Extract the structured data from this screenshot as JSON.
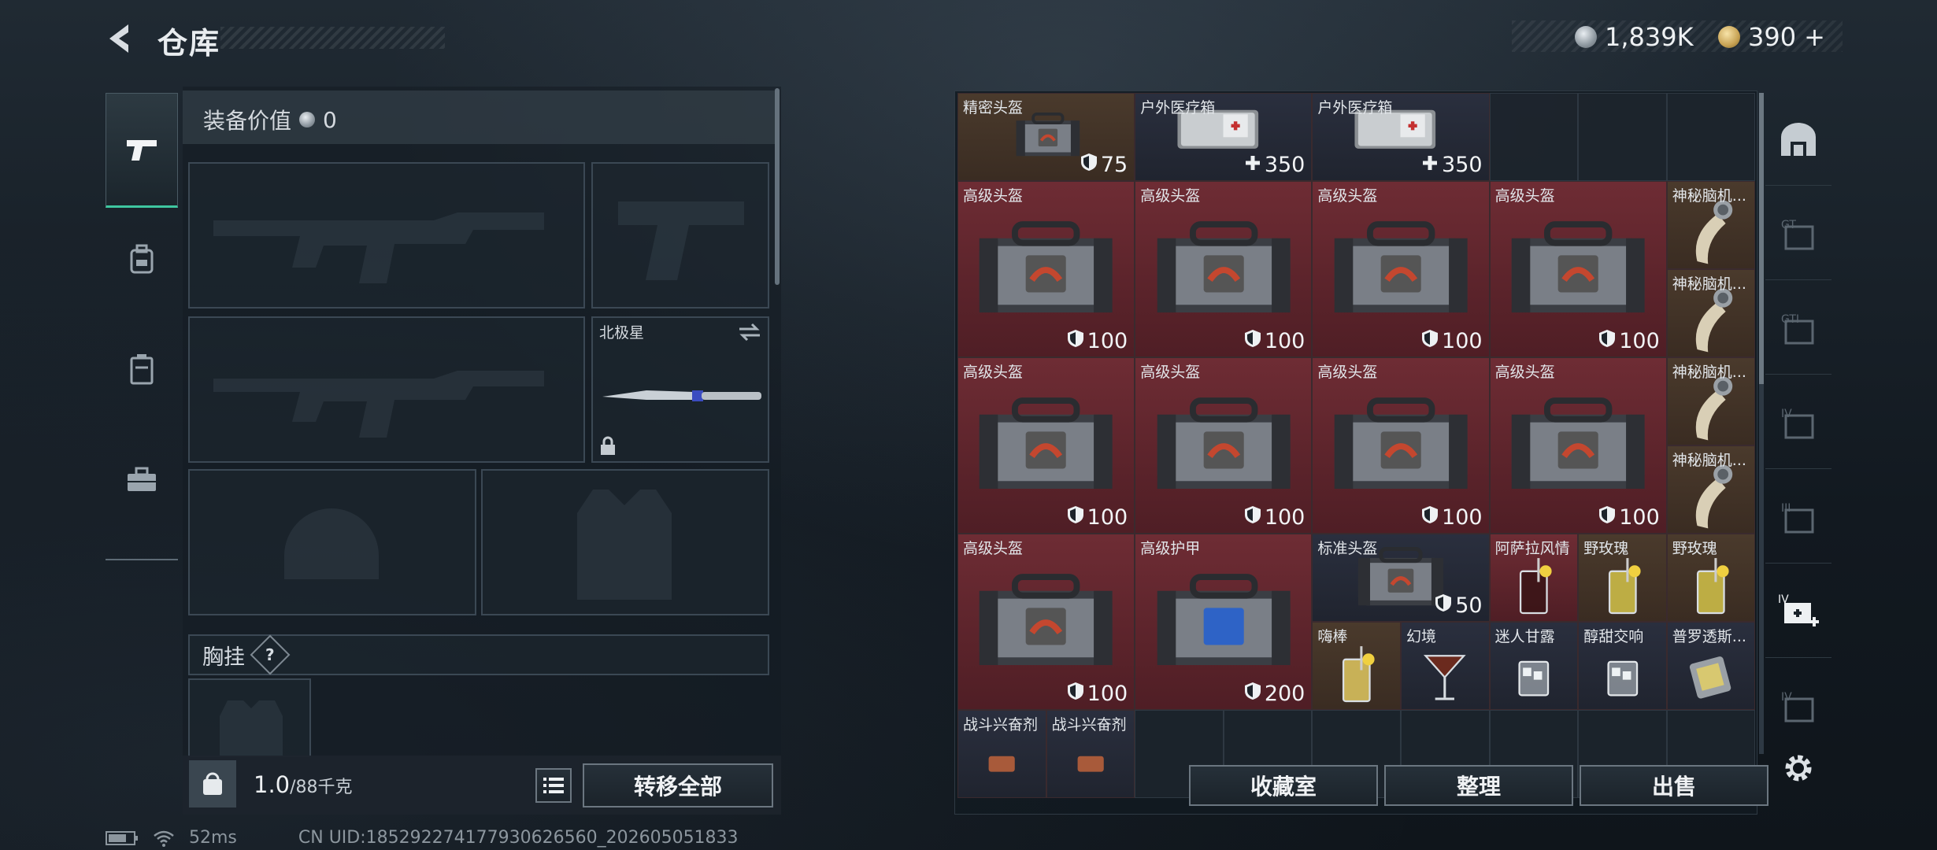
{
  "header": {
    "title": "仓库",
    "silver_amount": "1,839K",
    "gold_amount": "390",
    "gold_plus": "+"
  },
  "equipment": {
    "title": "装备价值",
    "value": "0",
    "melee_name": "北极星",
    "chest_rig_label": "胸挂",
    "chest_rig_help": "?",
    "weight_current": "1.0",
    "weight_max": "/88千克",
    "transfer_all": "转移全部"
  },
  "inventory": {
    "row0": [
      {
        "name": "精密头盔",
        "value": "75",
        "icon": "shield-icon"
      },
      {
        "name": "户外医疗箱",
        "value": "350",
        "icon": "plus-icon"
      },
      {
        "name": "户外医疗箱",
        "value": "350",
        "icon": "plus-icon"
      }
    ],
    "advanced_helmet": "高级头盔",
    "advanced_armor": "高级护甲",
    "standard_helmet": "标准头盔",
    "val_100": "100",
    "val_200": "200",
    "val_50": "50",
    "mystery": "神秘脑机...",
    "drinks": [
      "阿萨拉风情",
      "野玫瑰",
      "野玫瑰",
      "嗨棒",
      "幻境",
      "迷人甘露",
      "醇甜交响",
      "普罗透斯..."
    ],
    "combat_stim": "战斗兴奋剂"
  },
  "buttons": {
    "collection": "收藏室",
    "organize": "整理",
    "sell": "出售"
  },
  "status": {
    "ping": "52ms",
    "uid": "CN UID:18529227417793062656​0_202605051833"
  },
  "colors": {
    "accent": "#3fc7a0",
    "rare_bg": "#6e2c34",
    "epic_bg": "#4a3a2c"
  }
}
